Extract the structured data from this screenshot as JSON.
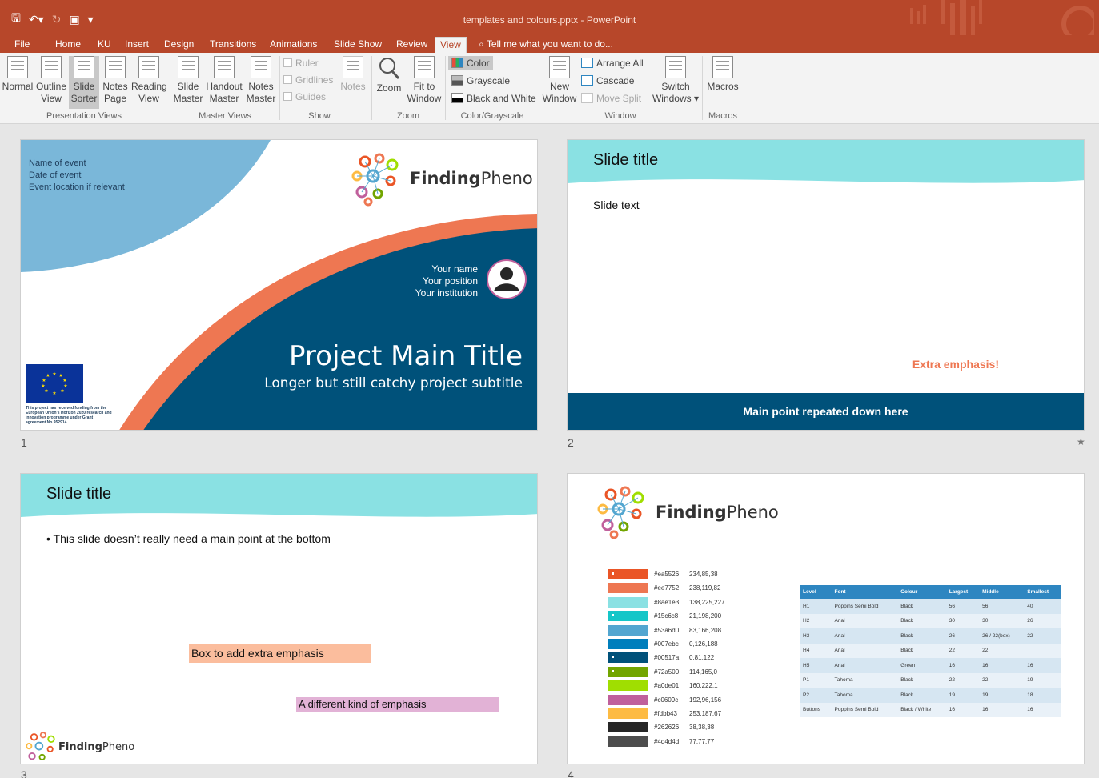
{
  "window": {
    "title": "templates and colours.pptx - PowerPoint",
    "qat": [
      "save-icon",
      "undo-icon",
      "redo-icon",
      "present-icon",
      "customize-icon"
    ]
  },
  "tabs": {
    "items": [
      "File",
      "Home",
      "KU",
      "Insert",
      "Design",
      "Transitions",
      "Animations",
      "Slide Show",
      "Review",
      "View"
    ],
    "active": "View",
    "tell_me": "Tell me what you want to do..."
  },
  "ribbon": {
    "presentation_views": {
      "label": "Presentation Views",
      "buttons": [
        {
          "line1": "Normal",
          "line2": ""
        },
        {
          "line1": "Outline",
          "line2": "View"
        },
        {
          "line1": "Slide",
          "line2": "Sorter"
        },
        {
          "line1": "Notes",
          "line2": "Page"
        },
        {
          "line1": "Reading",
          "line2": "View"
        }
      ]
    },
    "master_views": {
      "label": "Master Views",
      "buttons": [
        {
          "line1": "Slide",
          "line2": "Master"
        },
        {
          "line1": "Handout",
          "line2": "Master"
        },
        {
          "line1": "Notes",
          "line2": "Master"
        }
      ]
    },
    "show": {
      "label": "Show",
      "items": [
        "Ruler",
        "Gridlines",
        "Guides"
      ],
      "notes": "Notes"
    },
    "zoom": {
      "label": "Zoom",
      "zoom": "Zoom",
      "fit_line1": "Fit to",
      "fit_line2": "Window"
    },
    "color_grayscale": {
      "label": "Color/Grayscale",
      "items": [
        "Color",
        "Grayscale",
        "Black and White"
      ]
    },
    "window": {
      "label": "Window",
      "new_line1": "New",
      "new_line2": "Window",
      "items": [
        "Arrange All",
        "Cascade",
        "Move Split"
      ],
      "switch_line1": "Switch",
      "switch_line2": "Windows"
    },
    "macros": {
      "label": "Macros",
      "button": "Macros"
    }
  },
  "slides": {
    "s1": {
      "number": "1",
      "event_lines": [
        "Name of event",
        "Date of event",
        "Event location if relevant"
      ],
      "brand_bold": "Finding",
      "brand_light": "Pheno",
      "speaker_lines": [
        "Your name",
        "Your position",
        "Your institution"
      ],
      "title": "Project Main Title",
      "subtitle": "Longer but still catchy project subtitle",
      "funding": "This project has received funding from the European Union's Horizon 2020 research and innovation programme under Grant agreement No 952914"
    },
    "s2": {
      "number": "2",
      "title": "Slide title",
      "text": "Slide text",
      "emphasis": "Extra emphasis!",
      "footer": "Main point repeated down here"
    },
    "s3": {
      "number": "3",
      "title": "Slide title",
      "bullet": "This slide doesn’t really need a main point at the bottom",
      "box1": "Box to add extra emphasis",
      "box2": "A different kind of emphasis",
      "brand_bold": "Finding",
      "brand_light": "Pheno"
    },
    "s4": {
      "number": "4",
      "brand_bold": "Finding",
      "brand_light": "Pheno",
      "swatches": [
        {
          "hex": "#ea5526",
          "rgb": "234,85,38",
          "color": "#ea5526",
          "marked": true
        },
        {
          "hex": "#ee7752",
          "rgb": "238,119,82",
          "color": "#ee7752",
          "marked": false
        },
        {
          "hex": "#8ae1e3",
          "rgb": "138,225,227",
          "color": "#8ae1e3",
          "marked": false
        },
        {
          "hex": "#15c6c8",
          "rgb": "21,198,200",
          "color": "#15c6c8",
          "marked": true
        },
        {
          "hex": "#53a6d0",
          "rgb": "83,166,208",
          "color": "#53a6d0",
          "marked": false
        },
        {
          "hex": "#007ebc",
          "rgb": "0,126,188",
          "color": "#007ebc",
          "marked": false
        },
        {
          "hex": "#00517a",
          "rgb": "0,81,122",
          "color": "#00517a",
          "marked": true
        },
        {
          "hex": "#72a500",
          "rgb": "114,165,0",
          "color": "#72a500",
          "marked": true
        },
        {
          "hex": "#a0de01",
          "rgb": "160,222,1",
          "color": "#a0de01",
          "marked": false
        },
        {
          "hex": "#c0609c",
          "rgb": "192,96,156",
          "color": "#c0609c",
          "marked": false
        },
        {
          "hex": "#fdbb43",
          "rgb": "253,187,67",
          "color": "#fdbb43",
          "marked": false
        },
        {
          "hex": "#262626",
          "rgb": "38,38,38",
          "color": "#262626",
          "marked": false
        },
        {
          "hex": "#4d4d4d",
          "rgb": "77,77,77",
          "color": "#4d4d4d",
          "marked": false
        }
      ],
      "table": {
        "headers": [
          "Level",
          "Font",
          "Colour",
          "Largest",
          "Middle",
          "Smallest"
        ],
        "rows": [
          [
            "H1",
            "Poppins Semi Bold",
            "Black",
            "56",
            "56",
            "40"
          ],
          [
            "H2",
            "Arial",
            "Black",
            "30",
            "30",
            "26"
          ],
          [
            "H3",
            "Arial",
            "Black",
            "26",
            "26 / 22(box)",
            "22"
          ],
          [
            "H4",
            "Arial",
            "Black",
            "22",
            "22",
            ""
          ],
          [
            "H5",
            "Arial",
            "Green",
            "16",
            "16",
            "16"
          ],
          [
            "P1",
            "Tahoma",
            "Black",
            "22",
            "22",
            "19"
          ],
          [
            "P2",
            "Tahoma",
            "Black",
            "19",
            "19",
            "18"
          ],
          [
            "Buttons",
            "Poppins Semi Bold",
            "Black / White",
            "16",
            "16",
            "16"
          ]
        ]
      }
    }
  },
  "colors": {
    "ribbon_accent": "#b7472a",
    "teal": "#8ae1e3",
    "navy": "#00517a",
    "orange": "#ee7752",
    "sky": "#7ab7d9"
  }
}
